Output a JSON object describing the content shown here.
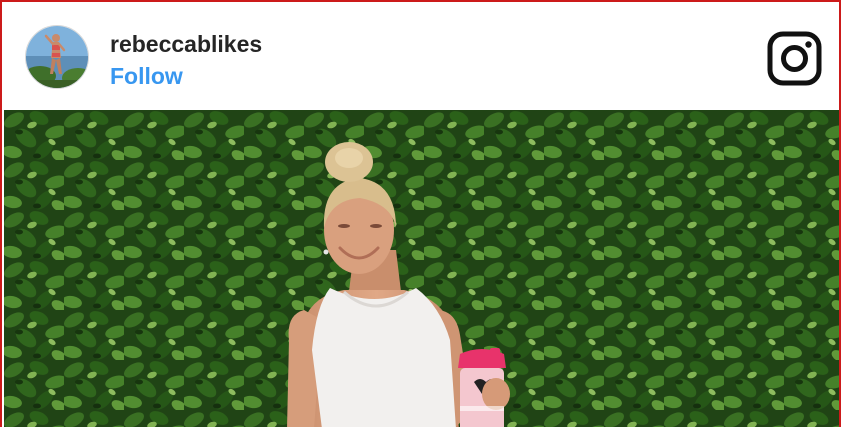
{
  "post": {
    "username": "rebeccablikes",
    "follow_label": "Follow"
  },
  "icons": {
    "avatar": "profile-photo",
    "brand": "instagram-icon"
  },
  "colors": {
    "follow": "#3897f0",
    "username": "#262626",
    "frame_border": "#cc1a1a"
  }
}
